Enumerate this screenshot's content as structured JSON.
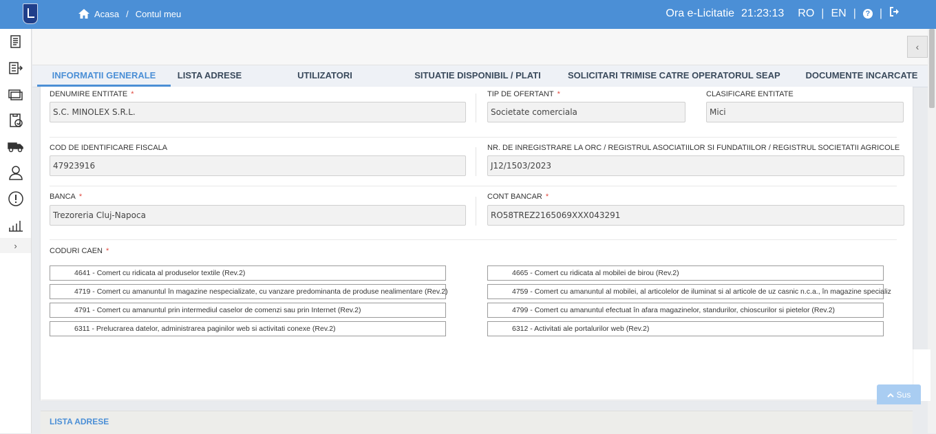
{
  "topbar": {
    "breadcrumb_home": "Acasa",
    "breadcrumb_sep": "/",
    "breadcrumb_current": "Contul meu",
    "clock_label": "Ora e-Licitatie",
    "clock_time": "21:23:13",
    "lang_ro": "RO",
    "lang_en": "EN",
    "sep": "|",
    "help_glyph": "?"
  },
  "toolbar": {
    "collapse_glyph": "‹"
  },
  "sidebar": {
    "icons": [
      "document-icon",
      "export-list-icon",
      "cards-icon",
      "clipboard-check-icon",
      "truck-icon",
      "user-icon",
      "alert-icon",
      "bar-chart-icon"
    ],
    "expand_glyph": "›"
  },
  "tabs": [
    {
      "label": "INFORMATII GENERALE",
      "active": true
    },
    {
      "label": "LISTA ADRESE"
    },
    {
      "label": "UTILIZATORI"
    },
    {
      "label": "SITUATIE DISPONIBIL / PLATI"
    },
    {
      "label": "SOLICITARI TRIMISE CATRE OPERATORUL SEAP"
    },
    {
      "label": "DOCUMENTE INCARCATE"
    }
  ],
  "form": {
    "denumire_label": "DENUMIRE ENTITATE",
    "denumire_value": "S.C. MINOLEX S.R.L.",
    "tip_label": "TIP DE OFERTANT",
    "tip_value": "Societate comerciala",
    "clasificare_label": "CLASIFICARE ENTITATE",
    "clasificare_value": "Mici",
    "cif_label": "COD DE IDENTIFICARE FISCALA",
    "cif_value": "47923916",
    "orc_label": "NR. DE INREGISTRARE LA ORC / REGISTRUL ASOCIATIILOR SI FUNDATIILOR / REGISTRUL SOCIETATII AGRICOLE",
    "orc_value": "J12/1503/2023",
    "banca_label": "BANCA",
    "banca_value": "Trezoreria Cluj-Napoca",
    "cont_label": "CONT BANCAR",
    "cont_value": "RO58TREZ2165069XXX043291",
    "caen_label": "CODURI CAEN",
    "required_mark": "*"
  },
  "caen_codes": [
    "4641 - Comert cu ridicata al produselor textile (Rev.2)",
    "4665 - Comert cu ridicata al mobilei de birou (Rev.2)",
    "4719 - Comert cu amanuntul în magazine nespecializate, cu vanzare predominanta de produse nealimentare (Rev.2)",
    "4759 - Comert cu amanuntul al mobilei, al articolelor de iluminat si al articole de uz casnic n.c.a., în magazine specializ",
    "4791 - Comert cu amanuntul prin intermediul caselor de comenzi sau prin Internet (Rev.2)",
    "4799 - Comert cu amanuntul efectuat în afara magazinelor, standurilor, chioscurilor si pietelor (Rev.2)",
    "6311 - Prelucrarea datelor, administrarea paginilor web si activitati conexe (Rev.2)",
    "6312 - Activitati ale portalurilor web (Rev.2)"
  ],
  "section2": {
    "title": "LISTA ADRESE"
  },
  "scroll_top": {
    "label": "Sus"
  },
  "colors": {
    "brand": "#4b8fd6",
    "required": "#e0483e"
  }
}
